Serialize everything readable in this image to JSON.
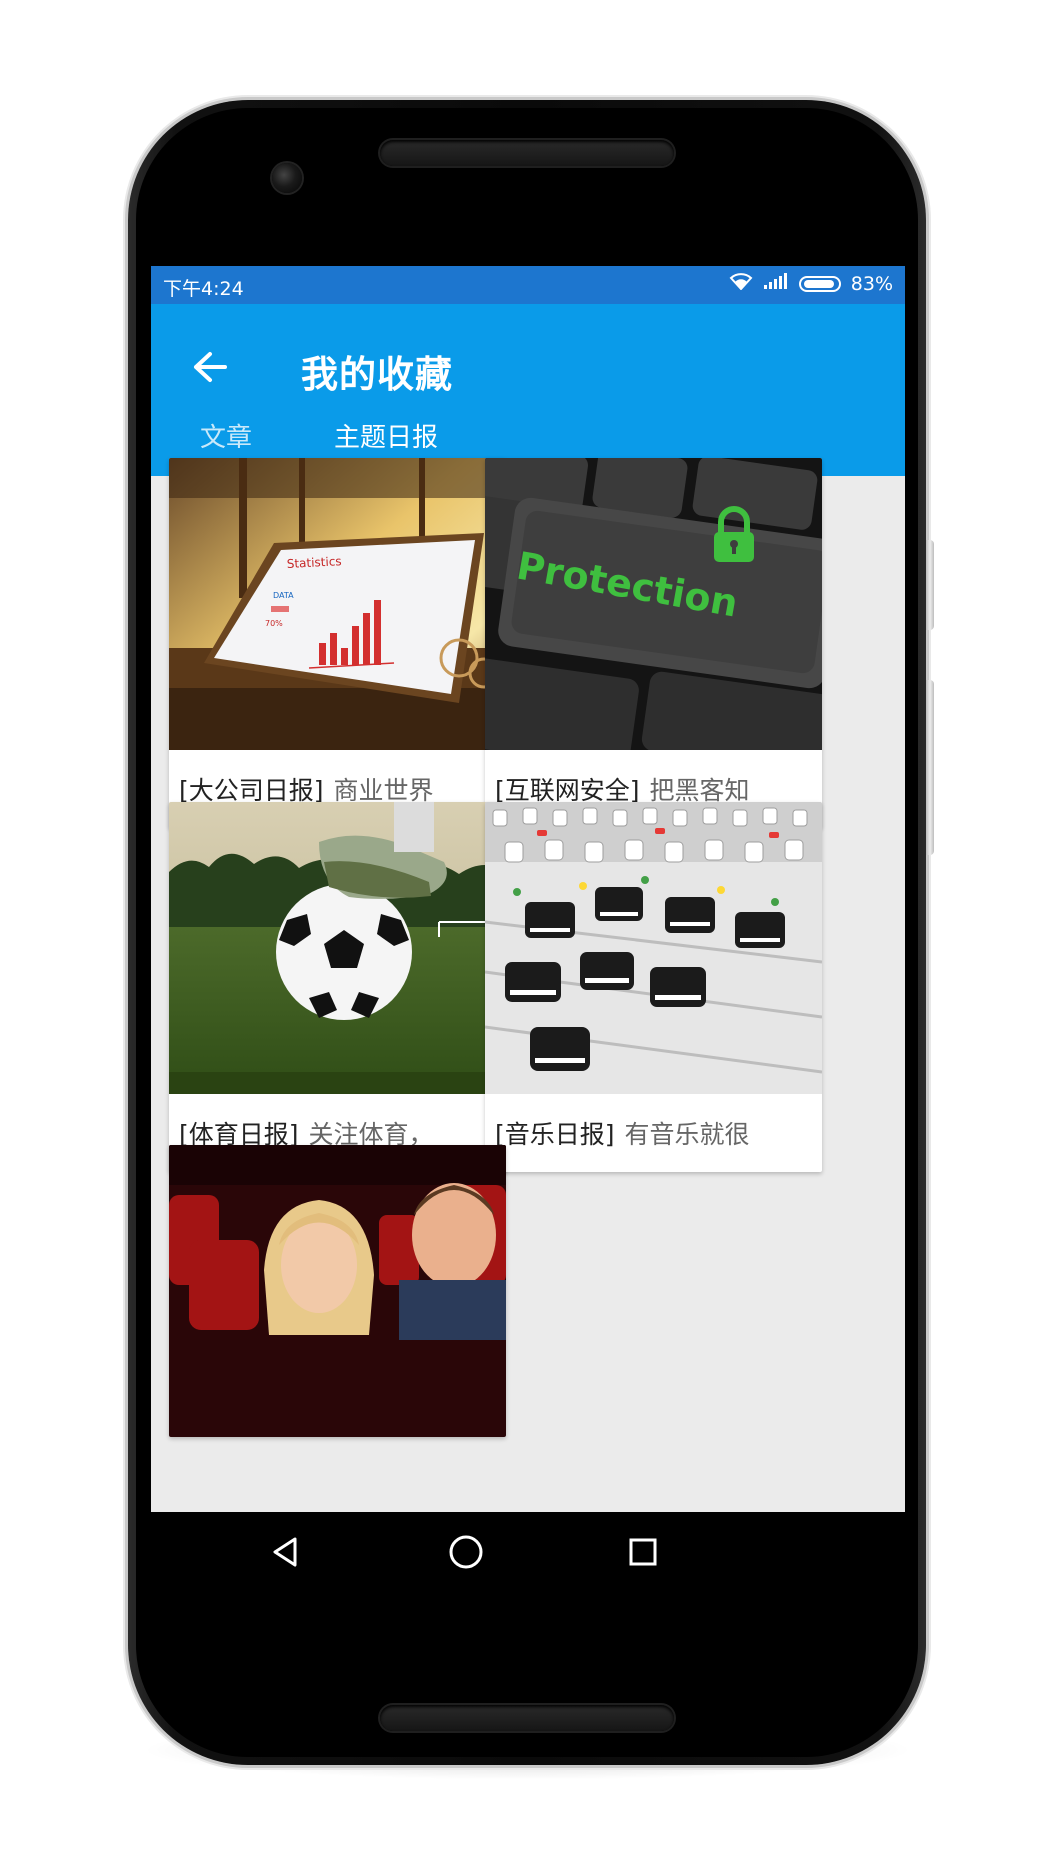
{
  "status_bar": {
    "time": "下午4:24",
    "battery_percent": "83%",
    "battery_level": 0.83,
    "icons": [
      "wifi-icon",
      "signal-icon",
      "battery-icon"
    ]
  },
  "toolbar": {
    "title": "我的收藏",
    "back_icon": "arrow-left-icon",
    "background": "#0a9be9"
  },
  "tabs": [
    {
      "label": "文章",
      "selected": false
    },
    {
      "label": "主题日报",
      "selected": true
    }
  ],
  "cards": [
    {
      "tag": "[大公司日报]",
      "desc": "商业世界",
      "image": "tablet-statistics-chart"
    },
    {
      "tag": "[互联网安全]",
      "desc": "把黑客知",
      "image": "keyboard-protection-key"
    },
    {
      "tag": "[体育日报]",
      "desc": "关注体育，",
      "image": "soccer-ball-on-grass"
    },
    {
      "tag": "[音乐日报]",
      "desc": "有音乐就很",
      "image": "audio-mixing-console"
    },
    {
      "tag": "",
      "desc": "",
      "image": "cinema-audience"
    }
  ],
  "image_text": {
    "statistics": "Statistics",
    "data": "DATA",
    "percent": "70%",
    "protection": "Protection"
  },
  "nav_bar": {
    "buttons": [
      "back-triangle-icon",
      "home-circle-icon",
      "recents-square-icon"
    ]
  },
  "colors": {
    "status_bar": "#1d76cf",
    "toolbar": "#0a9be9",
    "screen_bg": "#ebebeb"
  }
}
